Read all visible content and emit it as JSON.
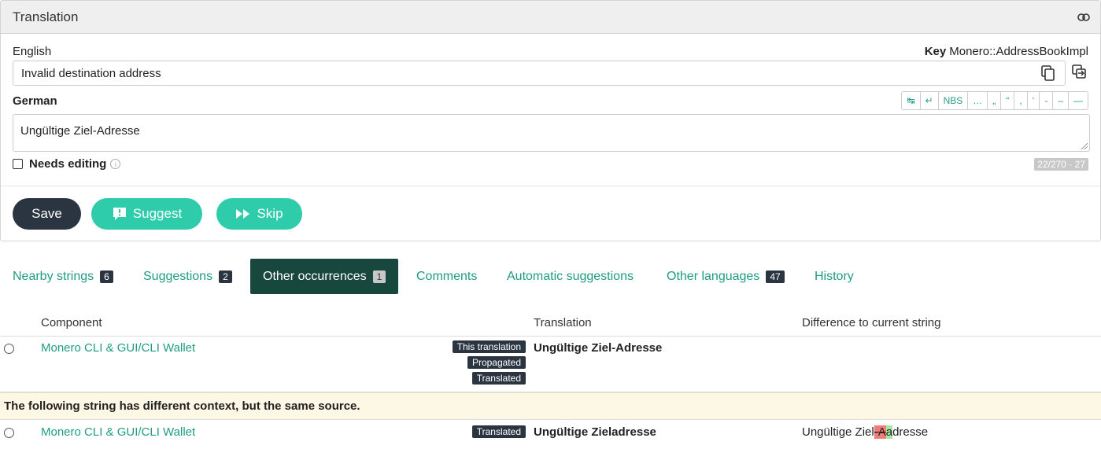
{
  "panel": {
    "title": "Translation"
  },
  "source": {
    "language": "English",
    "key_label": "Key",
    "key_value": "Monero::AddressBookImpl",
    "text": "Invalid destination address"
  },
  "target": {
    "language": "German",
    "text": "Ungültige Ziel-Adresse",
    "special_chars": [
      "↹",
      "↵",
      "NBS",
      "…",
      "„",
      "“",
      ",",
      "‘",
      "-",
      "–",
      "—"
    ],
    "needs_editing_label": "Needs editing",
    "counter": "22/270 · 27"
  },
  "actions": {
    "save": "Save",
    "suggest": "Suggest",
    "skip": "Skip"
  },
  "tabs": [
    {
      "label": "Nearby strings",
      "badge": "6"
    },
    {
      "label": "Suggestions",
      "badge": "2"
    },
    {
      "label": "Other occurrences",
      "badge": "1"
    },
    {
      "label": "Comments",
      "badge": ""
    },
    {
      "label": "Automatic suggestions",
      "badge": ""
    },
    {
      "label": "Other languages",
      "badge": "47"
    },
    {
      "label": "History",
      "badge": ""
    }
  ],
  "table": {
    "headers": {
      "component": "Component",
      "translation": "Translation",
      "difference": "Difference to current string"
    },
    "rows": [
      {
        "component": "Monero CLI & GUI/CLI Wallet",
        "labels": [
          "This translation",
          "Propagated",
          "Translated"
        ],
        "translation": "Ungültige Ziel-Adresse",
        "difference": ""
      },
      {
        "component": "Monero CLI & GUI/CLI Wallet",
        "labels": [
          "Translated"
        ],
        "translation": "Ungültige Zieladresse",
        "difference_prefix": "Ungültige Ziel",
        "difference_deleted": "-A",
        "difference_inserted": "a",
        "difference_suffix": "dresse"
      }
    ],
    "notice": "The following string has different context, but the same source."
  },
  "colors": {
    "accent": "#2eccaa",
    "dark": "#2b3441",
    "active_tab": "#18473d",
    "link": "#1f9c84"
  }
}
